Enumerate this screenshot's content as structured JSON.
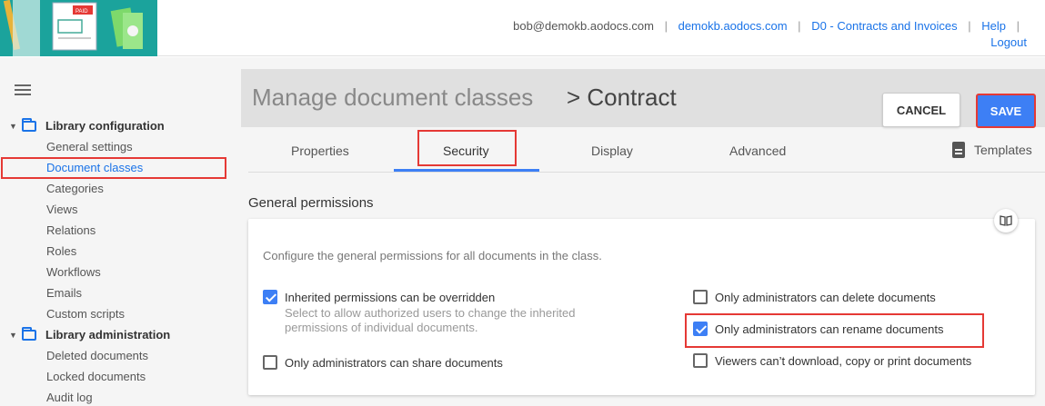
{
  "header": {
    "email": "bob@demokb.aodocs.com",
    "domain_link": "demokb.aodocs.com",
    "library_link": "D0 - Contracts and Invoices",
    "help_link": "Help",
    "logout_link": "Logout",
    "logo_badge": "PAID"
  },
  "sidebar": {
    "groups": [
      {
        "label": "Library configuration",
        "items": [
          "General settings",
          "Document classes",
          "Categories",
          "Views",
          "Relations",
          "Roles",
          "Workflows",
          "Emails",
          "Custom scripts"
        ]
      },
      {
        "label": "Library administration",
        "items": [
          "Deleted documents",
          "Locked documents",
          "Audit log"
        ]
      }
    ],
    "active_item": "Document classes"
  },
  "page": {
    "title": "Manage document classes",
    "subtitle": "> Contract",
    "cancel_label": "CANCEL",
    "save_label": "SAVE"
  },
  "tabs": {
    "properties": "Properties",
    "security": "Security",
    "display": "Display",
    "advanced": "Advanced",
    "templates": "Templates",
    "active": "Security"
  },
  "permissions": {
    "section_title": "General permissions",
    "description": "Configure the general permissions for all documents in the class.",
    "inherited_label": "Inherited permissions can be overridden",
    "inherited_checked": true,
    "inherited_help": "Select to allow authorized users to change the inherited permissions of individual documents.",
    "share_label": "Only administrators can share documents",
    "share_checked": false,
    "delete_label": "Only administrators can delete documents",
    "delete_checked": false,
    "rename_label": "Only administrators can rename documents",
    "rename_checked": true,
    "download_label": "Viewers can’t download, copy or print documents",
    "download_checked": false
  },
  "colors": {
    "accent": "#3d7ff5",
    "link": "#1a73e8",
    "highlight": "#e53935",
    "logo_bg": "#1ba39c"
  }
}
